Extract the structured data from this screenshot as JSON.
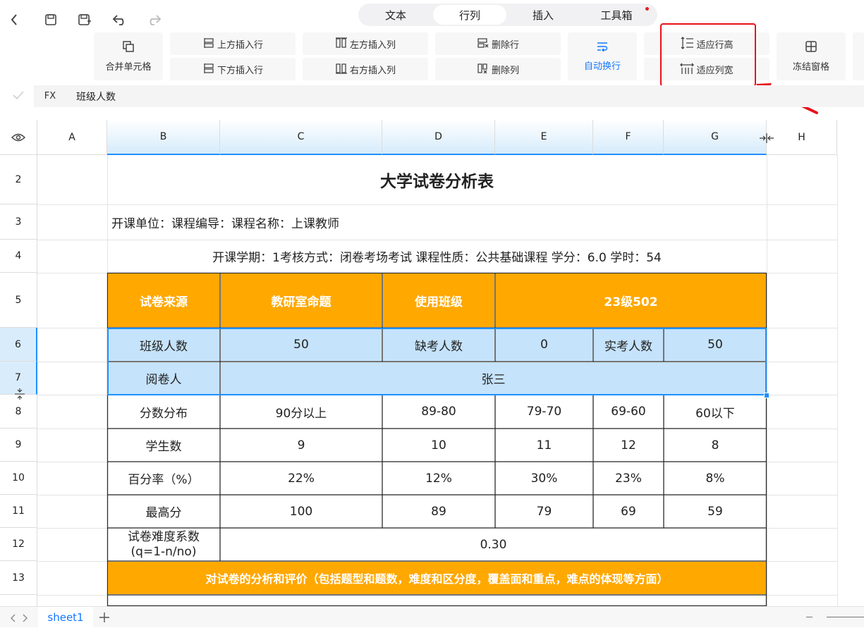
{
  "toolbar": {
    "icons": [
      "back-icon",
      "save-icon",
      "save-as-icon",
      "undo-icon",
      "redo-icon"
    ]
  },
  "tabs": [
    "文本",
    "行列",
    "插入",
    "工具箱"
  ],
  "ribbon": {
    "merge_cells": "合并单元格",
    "insert_row_above": "上方插入行",
    "insert_row_below": "下方插入行",
    "insert_col_left": "左方插入列",
    "insert_col_right": "右方插入列",
    "delete_row": "删除行",
    "delete_col": "删除列",
    "auto_wrap": "自动换行",
    "fit_row_height": "适应行高",
    "fit_col_width": "适应列宽",
    "freeze_panes": "冻结窗格"
  },
  "formula_bar": {
    "fx_label": "FX",
    "value": "班级人数"
  },
  "columns": [
    "A",
    "B",
    "C",
    "D",
    "E",
    "F",
    "G",
    "H"
  ],
  "rows": [
    "2",
    "3",
    "4",
    "5",
    "6",
    "7",
    "8",
    "9",
    "10",
    "11",
    "12",
    "13"
  ],
  "sheet": {
    "title": "大学试卷分析表",
    "row3": "开课单位：课程编导：课程名称：上课教师",
    "row4": "开课学期：1考核方式：闭卷考场考试  课程性质：公共基础课程  学分：6.0 学时：54",
    "row5": [
      "试卷来源",
      "教研室命题",
      "使用班级",
      "23级502"
    ],
    "row6": [
      "班级人数",
      "50",
      "缺考人数",
      "0",
      "实考人数",
      "50"
    ],
    "row7": [
      "阅卷人",
      "张三"
    ],
    "row8": [
      "分数分布",
      "90分以上",
      "89-80",
      "79-70",
      "69-60",
      "60以下"
    ],
    "row9": [
      "学生数",
      "9",
      "10",
      "11",
      "12",
      "8"
    ],
    "row10": [
      "百分率（%）",
      "22%",
      "12%",
      "30%",
      "23%",
      "8%"
    ],
    "row11": [
      "最高分",
      "100",
      "89",
      "79",
      "69",
      "59"
    ],
    "row12_label_1": "试卷难度系数",
    "row12_label_2": "(q=1-n/no)",
    "row12_value": "0.30",
    "row13": "对试卷的分析和评价（包括题型和题数，难度和区分度，覆盖面和重点，难点的体现等方面）"
  },
  "sheet_tabs": [
    "sheet1"
  ],
  "colors": {
    "accent": "#1677ff",
    "orange": "#ffa800",
    "light_blue": "#c5e3fb",
    "highlight_red": "#e8101a"
  }
}
